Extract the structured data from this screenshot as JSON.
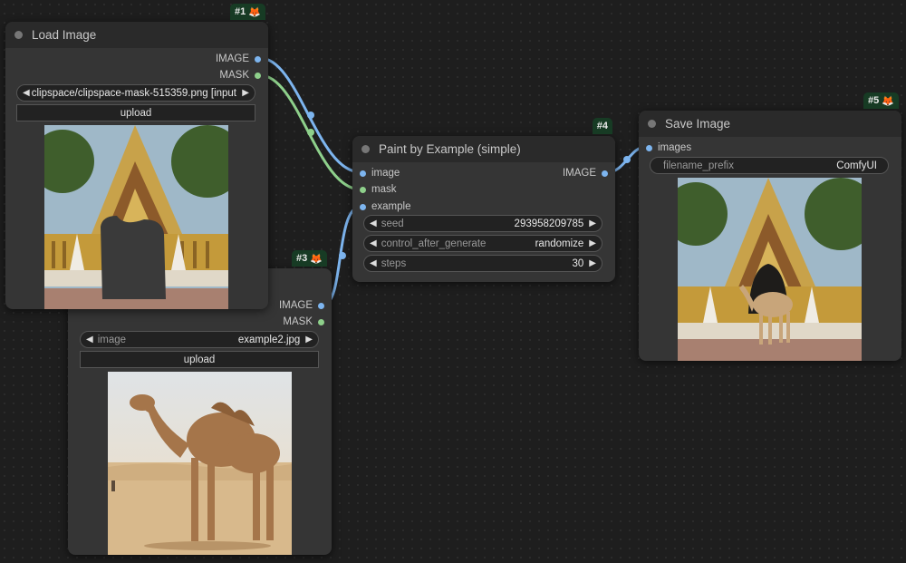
{
  "colors": {
    "image_wire": "#7db5ef",
    "mask_wire": "#8ed08b",
    "badge_bg": "#173b24"
  },
  "nodes": {
    "load_image": {
      "id": "#1",
      "title": "Load Image",
      "outputs": [
        "IMAGE",
        "MASK"
      ],
      "image_widget": {
        "value": "clipspace/clipspace-mask-515359.png [input]"
      },
      "upload_label": "upload",
      "preview": "temple-with-masked-door"
    },
    "load_example": {
      "id": "#3",
      "outputs": [
        "IMAGE",
        "MASK"
      ],
      "image_widget": {
        "label": "image",
        "value": "example2.jpg"
      },
      "upload_label": "upload",
      "preview": "camel-in-desert"
    },
    "paint_by_example": {
      "id": "#4",
      "title": "Paint by Example (simple)",
      "inputs": [
        "image",
        "mask",
        "example"
      ],
      "output": "IMAGE",
      "widgets": [
        {
          "label": "seed",
          "value": "293958209785"
        },
        {
          "label": "control_after_generate",
          "value": "randomize"
        },
        {
          "label": "steps",
          "value": "30"
        }
      ]
    },
    "save_image": {
      "id": "#5",
      "title": "Save Image",
      "input": "images",
      "filename_prefix": {
        "label": "filename_prefix",
        "value": "ComfyUI"
      },
      "preview": "temple-with-camel"
    }
  },
  "icons": {
    "badge": "fox-icon",
    "left": "arrow-left-icon",
    "right": "arrow-right-icon"
  }
}
